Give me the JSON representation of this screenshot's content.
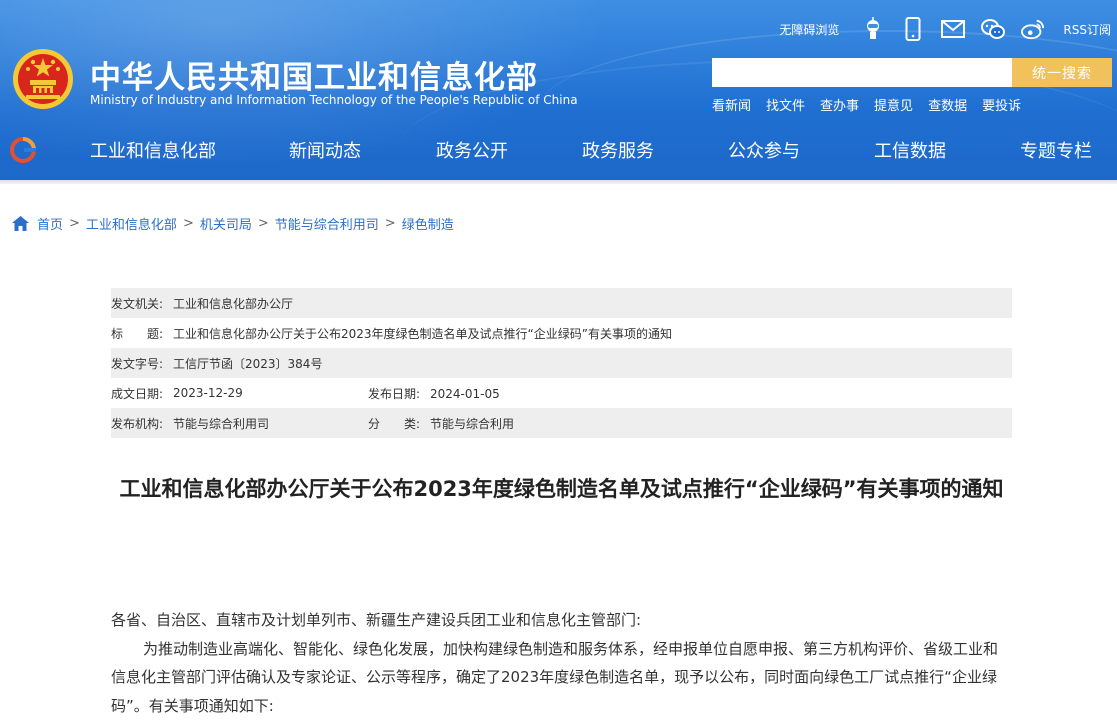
{
  "header": {
    "site_name_cn": "中华人民共和国工业和信息化部",
    "site_name_en": "Ministry of Industry and Information Technology of the People's Republic of China",
    "accessibility": "无障碍浏览",
    "rss": "RSS订阅",
    "icons": [
      "robot-icon",
      "mobile-icon",
      "mail-icon",
      "wechat-icon",
      "weibo-icon"
    ],
    "search_placeholder": "",
    "search_button": "统一搜索",
    "quick_links": [
      "看新闻",
      "找文件",
      "查办事",
      "提意见",
      "查数据",
      "要投诉"
    ]
  },
  "nav": [
    "工业和信息化部",
    "新闻动态",
    "政务公开",
    "政务服务",
    "公众参与",
    "工信数据",
    "专题专栏"
  ],
  "breadcrumb": [
    "首页",
    "工业和信息化部",
    "机关司局",
    "节能与综合利用司",
    "绿色制造"
  ],
  "meta": {
    "issuer_label": "发文机关:",
    "issuer": "工业和信息化部办公厅",
    "title_label": "标　　题:",
    "title": "工业和信息化部办公厅关于公布2023年度绿色制造名单及试点推行“企业绿码”有关事项的通知",
    "doc_no_label": "发文字号:",
    "doc_no": "工信厅节函〔2023〕384号",
    "written_label": "成文日期:",
    "written": "2023-12-29",
    "published_label": "发布日期:",
    "published": "2024-01-05",
    "org_label": "发布机构:",
    "org": "节能与综合利用司",
    "category_label": "分　　类:",
    "category": "节能与综合利用"
  },
  "document": {
    "title": "工业和信息化部办公厅关于公布2023年度绿色制造名单及试点推行“企业绿码”有关事项的通知",
    "salutation": "各省、自治区、直辖市及计划单列市、新疆生产建设兵团工业和信息化主管部门:",
    "paragraph1": "为推动制造业高端化、智能化、绿色化发展，加快构建绿色制造和服务体系，经申报单位自愿申报、第三方机构评价、省级工业和信息化主管部门评估确认及专家论证、公示等程序，确定了2023年度绿色制造名单，现予以公布，同时面向绿色工厂试点推行“企业绿码”。有关事项通知如下:"
  },
  "colors": {
    "header_blue": "#1f6fd2",
    "search_button": "#f1c15c",
    "link_blue": "#2a6fc9",
    "meta_row_gray": "#eeeeee",
    "emblem_red": "#d8261c",
    "emblem_gold": "#f5c935"
  }
}
